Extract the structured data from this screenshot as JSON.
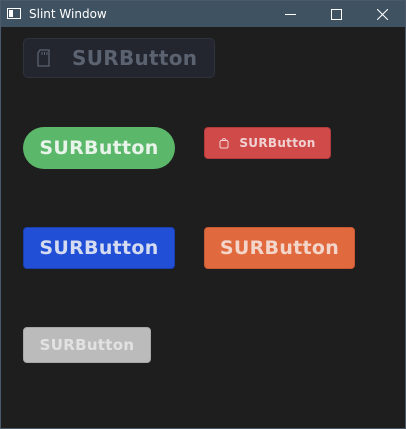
{
  "window": {
    "title": "Slint Window",
    "icon": "slint-app-icon",
    "controls": {
      "minimize_icon": "minimize-icon",
      "maximize_icon": "maximize-icon",
      "close_icon": "close-icon"
    }
  },
  "buttons": [
    {
      "label": "SURButton",
      "icon": "sd-card-icon",
      "style": "disabled-dark",
      "color": "#23262f"
    },
    {
      "label": "SURButton",
      "style": "success-pill",
      "color": "#5bb86a"
    },
    {
      "label": "SURButton",
      "icon": "bag-icon",
      "style": "danger-small",
      "color": "#d04a4a"
    },
    {
      "label": "SURButton",
      "style": "primary",
      "color": "#2150d6"
    },
    {
      "label": "SURButton",
      "style": "warning",
      "color": "#e1693e"
    },
    {
      "label": "SURButton",
      "style": "disabled-light",
      "color": "#bbbbbb"
    }
  ],
  "colors": {
    "titlebar": "#3f5261",
    "background": "#1e1e1e"
  }
}
